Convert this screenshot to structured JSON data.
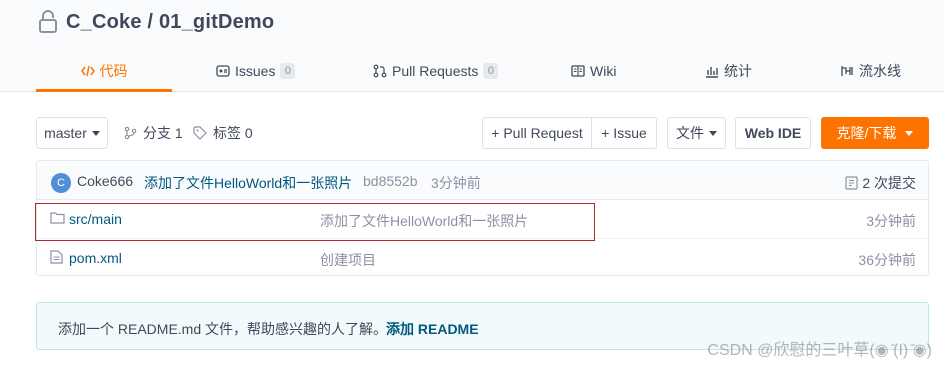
{
  "repo": {
    "title": "C_Coke / 01_gitDemo"
  },
  "tabs": [
    {
      "label": "代码",
      "icon": "code-icon",
      "active": true
    },
    {
      "label": "Issues",
      "icon": "issues-icon",
      "badge": "0"
    },
    {
      "label": "Pull Requests",
      "icon": "pull-request-icon",
      "badge": "0"
    },
    {
      "label": "Wiki",
      "icon": "wiki-icon"
    },
    {
      "label": "统计",
      "icon": "stats-icon"
    },
    {
      "label": "流水线",
      "icon": "pipeline-icon"
    }
  ],
  "toolbar": {
    "branch": "master",
    "branches": "分支 1",
    "tags": "标签 0",
    "new_pr": "+ Pull Request",
    "new_issue": "+ Issue",
    "file_menu": "文件",
    "web_ide": "Web IDE",
    "clone": "克隆/下载"
  },
  "latest_commit": {
    "avatar_letter": "C",
    "author": "Coke666",
    "message": "添加了文件HelloWorld和一张照片",
    "hash": "bd8552b",
    "time": "3分钟前",
    "commits": "2 次提交"
  },
  "files": [
    {
      "name": "src/main",
      "type": "folder",
      "message": "添加了文件HelloWorld和一张照片",
      "time": "3分钟前"
    },
    {
      "name": "pom.xml",
      "type": "file",
      "message": "创建项目",
      "time": "36分钟前"
    }
  ],
  "readme_notice": {
    "text": "添加一个 README.md 文件，帮助感兴趣的人了解。",
    "link": "添加 README"
  },
  "watermark": "CSDN @欣慰的三叶草(◉ ̄(I) ̄◉)",
  "colors": {
    "accent": "#fe7300",
    "link": "#005980",
    "highlight_box": "#b3262d"
  }
}
